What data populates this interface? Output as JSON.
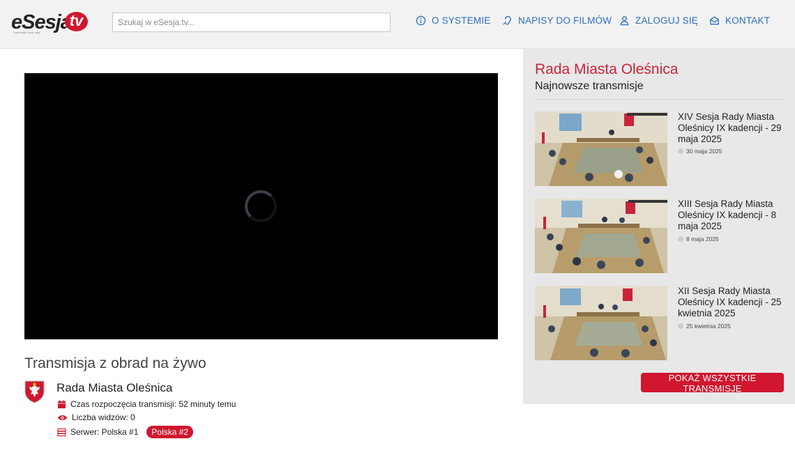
{
  "header": {
    "logo_text": "eSesja",
    "logo_tv": "tv",
    "logo_tagline": "Transmisje sesji rady",
    "search_placeholder": "Szukaj w eSesja.tv...",
    "nav": [
      {
        "label": "O SYSTEMIE",
        "icon": "info-icon"
      },
      {
        "label": "NAPISY DO FILMÓW",
        "icon": "ear-icon"
      },
      {
        "label": "ZALOGUJ SIĘ",
        "icon": "user-icon"
      },
      {
        "label": "KONTAKT",
        "icon": "envelope-icon"
      }
    ]
  },
  "colors": {
    "accent": "#d0172f",
    "link": "#2b6fbf",
    "sidebar_bg": "#e8e8e8"
  },
  "player": {
    "state": "loading"
  },
  "live": {
    "title": "Transmisja z obrad na żywo",
    "org": "Rada Miasta Oleśnica",
    "start_time": "Czas rozpoczęcia transmisji: 52 minuty temu",
    "viewers": "Liczba widzów: 0",
    "server": "Serwer: Polska #1",
    "server_alt": "Polska #2"
  },
  "sidebar": {
    "title": "Rada Miasta Oleśnica",
    "subtitle": "Najnowsze transmisje",
    "items": [
      {
        "title": "XIV Sesja Rady Miasta Oleśnicy IX kadencji - 29 maja 2025",
        "date": "30 maja 2025"
      },
      {
        "title": "XIII Sesja Rady Miasta Oleśnicy IX kadencji - 8 maja 2025",
        "date": "8 maja 2025"
      },
      {
        "title": "XII Sesja Rady Miasta Oleśnicy IX kadencji - 25 kwietnia 2025",
        "date": "25 kwietnia 2025"
      }
    ],
    "show_all": "POKAŻ WSZYSTKIE TRANSMISJE"
  }
}
